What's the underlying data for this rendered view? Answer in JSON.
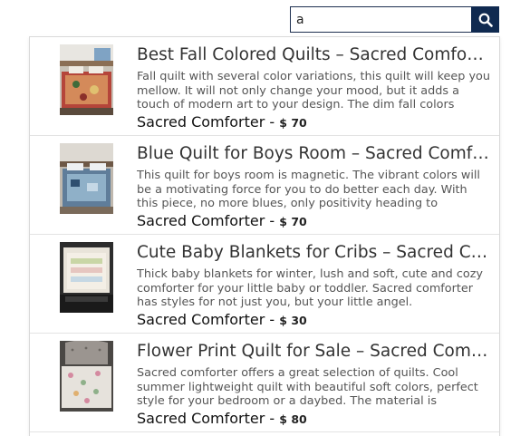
{
  "search": {
    "value": "a",
    "button_icon": "search-icon",
    "button_color": "#102a50"
  },
  "results": [
    {
      "title": "Best Fall Colored Quilts – Sacred Comforter",
      "description": "Fall quilt with several color variations, this quilt will keep you mellow. It will not only change your mood, but it adds a touch of modern art to your design. The dim fall colors",
      "brand": "Sacred Comforter",
      "separator": "-",
      "price": "$ 70"
    },
    {
      "title": "Blue Quilt for Boys Room – Sacred Comforter",
      "description": "This quilt for boys room is magnetic. The vibrant colors will be a motivating force for you to do better each day. With this piece, no more blues, only positivity heading to",
      "brand": "Sacred Comforter",
      "separator": "-",
      "price": "$ 70"
    },
    {
      "title": "Cute Baby Blankets for Cribs – Sacred Comforter",
      "description": "Thick baby blankets for winter, lush and soft, cute and cozy comforter for your little baby or toddler. Sacred comforter has styles for not just you, but your little angel.",
      "brand": "Sacred Comforter",
      "separator": "-",
      "price": "$ 30"
    },
    {
      "title": "Flower Print Quilt for Sale – Sacred Comforter",
      "description": "Sacred comforter offers a great selection of quilts.  Cool summer lightweight quilt with beautiful soft colors, perfect style for your bedroom or a daybed. The material is",
      "brand": "Sacred Comforter",
      "separator": "-",
      "price": "$ 80"
    }
  ]
}
